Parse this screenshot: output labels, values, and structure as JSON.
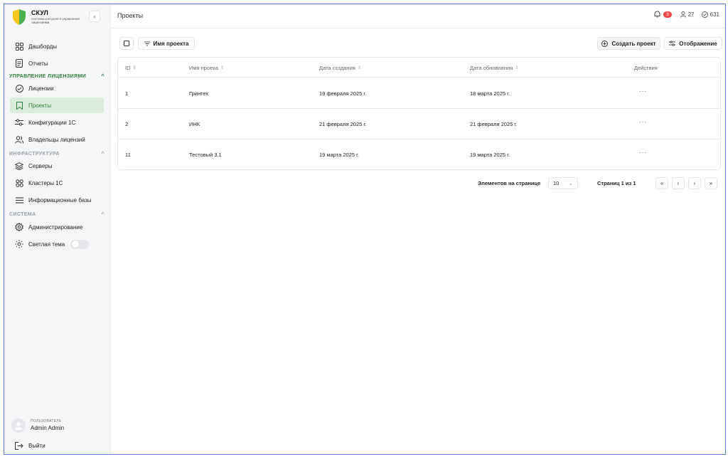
{
  "brand": {
    "title": "СКУЛ",
    "subtitle": "Система контроля и управления лицензиями",
    "collapse_icon": "chevron-left-icon"
  },
  "colors": {
    "accent": "#2f7d3a",
    "active_bg": "#dcecdc",
    "section_active": "#2f7d3a",
    "section_muted": "#9aa0a6",
    "badge": "#ef4a4a",
    "frame_border": "#5b7fd8"
  },
  "sidebar": {
    "top_items": [
      {
        "label": "Дашборды",
        "icon": "dashboard-icon"
      },
      {
        "label": "Отчеты",
        "icon": "report-icon"
      }
    ],
    "sections": [
      {
        "title": "УПРАВЛЕНИЕ ЛИЦЕНЗИЯМИ",
        "items": [
          {
            "label": "Лицензии",
            "icon": "check-circle-icon"
          },
          {
            "label": "Проекты",
            "icon": "bookmark-icon",
            "active": true
          },
          {
            "label": "Конфигурации 1С",
            "icon": "sliders-icon"
          },
          {
            "label": "Владельцы лицензий",
            "icon": "users-icon"
          }
        ]
      },
      {
        "title": "ИНФРАСТРУКТУРА",
        "items": [
          {
            "label": "Серверы",
            "icon": "layers-icon"
          },
          {
            "label": "Кластеры 1С",
            "icon": "cluster-icon"
          },
          {
            "label": "Информационные базы",
            "icon": "list-icon"
          }
        ]
      },
      {
        "title": "СИСТЕМА",
        "items": [
          {
            "label": "Администрирование",
            "icon": "gear-icon"
          },
          {
            "label": "Светлая тема",
            "icon": "sun-icon",
            "toggle": false
          }
        ]
      }
    ],
    "user": {
      "role": "ПОЛЬЗОВАТЕЛЬ",
      "name": "Admin Admin"
    },
    "logout": "Выйти"
  },
  "header": {
    "title": "Проекты",
    "notifications": "3",
    "users_count": "27",
    "licenses_count": "631"
  },
  "toolbar": {
    "filter_label": "Имя проекта",
    "create_label": "Создать проект",
    "view_label": "Отображение"
  },
  "table": {
    "columns": [
      "ID",
      "Имя проека",
      "Дата создания",
      "Дата обновления",
      "Действия"
    ],
    "rows": [
      {
        "id": "1",
        "name": "Гринтех",
        "created": "19 февраля 2025 г.",
        "updated": "18 марта 2025 г.",
        "actions": "···"
      },
      {
        "id": "2",
        "name": "ИНК",
        "created": "21 февраля 2025 г.",
        "updated": "21 февраля 2025 г.",
        "actions": "···"
      },
      {
        "id": "11",
        "name": "Тестовый 3.1",
        "created": "19 марта 2025 г.",
        "updated": "19 марта 2025 г.",
        "actions": "···"
      }
    ]
  },
  "pagination": {
    "per_page_label": "Элементов на странице",
    "per_page_value": "10",
    "page_info": "Страниц 1 из 1",
    "first": "«",
    "prev": "‹",
    "next": "›",
    "last": "»"
  }
}
